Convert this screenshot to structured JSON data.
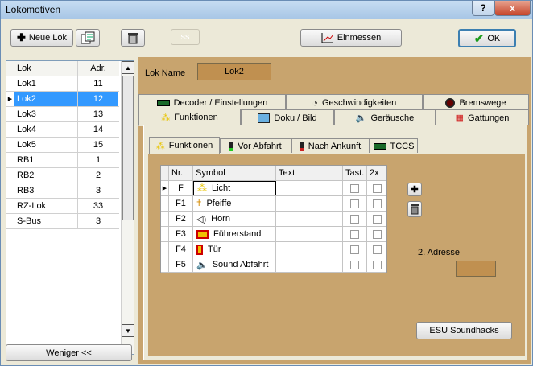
{
  "window": {
    "title": "Lokomotiven",
    "help": "?",
    "close": "x"
  },
  "toolbar": {
    "new_loco": "Neue Lok",
    "copy_icon": "copy-icon",
    "delete_icon": "trash-icon",
    "dimmed": "ss",
    "calibrate": "Einmessen",
    "ok": "OK"
  },
  "loco_list": {
    "headers": [
      "Lok",
      "Adr."
    ],
    "rows": [
      {
        "name": "Lok1",
        "addr": "11"
      },
      {
        "name": "Lok2",
        "addr": "12",
        "selected": true
      },
      {
        "name": "Lok3",
        "addr": "13"
      },
      {
        "name": "Lok4",
        "addr": "14"
      },
      {
        "name": "Lok5",
        "addr": "15"
      },
      {
        "name": "RB1",
        "addr": "1"
      },
      {
        "name": "RB2",
        "addr": "2"
      },
      {
        "name": "RB3",
        "addr": "3"
      },
      {
        "name": "RZ-Lok",
        "addr": "33"
      },
      {
        "name": "S-Bus",
        "addr": "3"
      }
    ],
    "less_button": "Weniger <<"
  },
  "detail": {
    "loco_name_label": "Lok Name",
    "loco_name_value": "Lok2",
    "tabs_row1": [
      "Decoder / Einstellungen",
      "Geschwindigkeiten",
      "Bremswege"
    ],
    "tabs_row2": [
      "Funktionen",
      "Doku / Bild",
      "Geräusche",
      "Gattungen"
    ],
    "subtabs": [
      "Funktionen",
      "Vor Abfahrt",
      "Nach Ankunft",
      "TCCS"
    ],
    "table_headers": [
      "Nr.",
      "Symbol",
      "Text",
      "Tast.",
      "2x"
    ],
    "functions": [
      {
        "nr": "F",
        "symbol": "Licht"
      },
      {
        "nr": "F1",
        "symbol": "Pfeiffe"
      },
      {
        "nr": "F2",
        "symbol": "Horn"
      },
      {
        "nr": "F3",
        "symbol": "Führerstand"
      },
      {
        "nr": "F4",
        "symbol": "Tür"
      },
      {
        "nr": "F5",
        "symbol": "Sound Abfahrt"
      }
    ],
    "second_address_label": "2. Adresse",
    "esu_button": "ESU Soundhacks"
  },
  "colors": {
    "accent_panel": "#c8a46e",
    "selected_row": "#3399ff",
    "name_field": "#c09050"
  }
}
